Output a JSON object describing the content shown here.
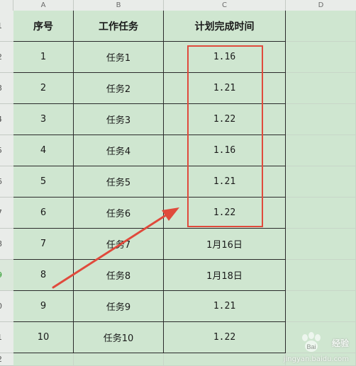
{
  "columns": [
    "A",
    "B",
    "C",
    "D"
  ],
  "row_numbers": [
    "1",
    "2",
    "3",
    "4",
    "5",
    "6",
    "7",
    "8",
    "9",
    "0",
    "1",
    "2"
  ],
  "table": {
    "headers": [
      "序号",
      "工作任务",
      "计划完成时间"
    ],
    "rows": [
      [
        "1",
        "任务1",
        "1.16"
      ],
      [
        "2",
        "任务2",
        "1.21"
      ],
      [
        "3",
        "任务3",
        "1.22"
      ],
      [
        "4",
        "任务4",
        "1.16"
      ],
      [
        "5",
        "任务5",
        "1.21"
      ],
      [
        "6",
        "任务6",
        "1.22"
      ],
      [
        "7",
        "任务7",
        "1月16日"
      ],
      [
        "8",
        "任务8",
        "1月18日"
      ],
      [
        "9",
        "任务9",
        "1.21"
      ],
      [
        "10",
        "任务10",
        "1.22"
      ]
    ]
  },
  "annotation": {
    "box_color": "#e04a3c",
    "arrow_color": "#e04a3c"
  },
  "watermark": {
    "text": "经验",
    "url": "jingyan.baidu.com"
  }
}
